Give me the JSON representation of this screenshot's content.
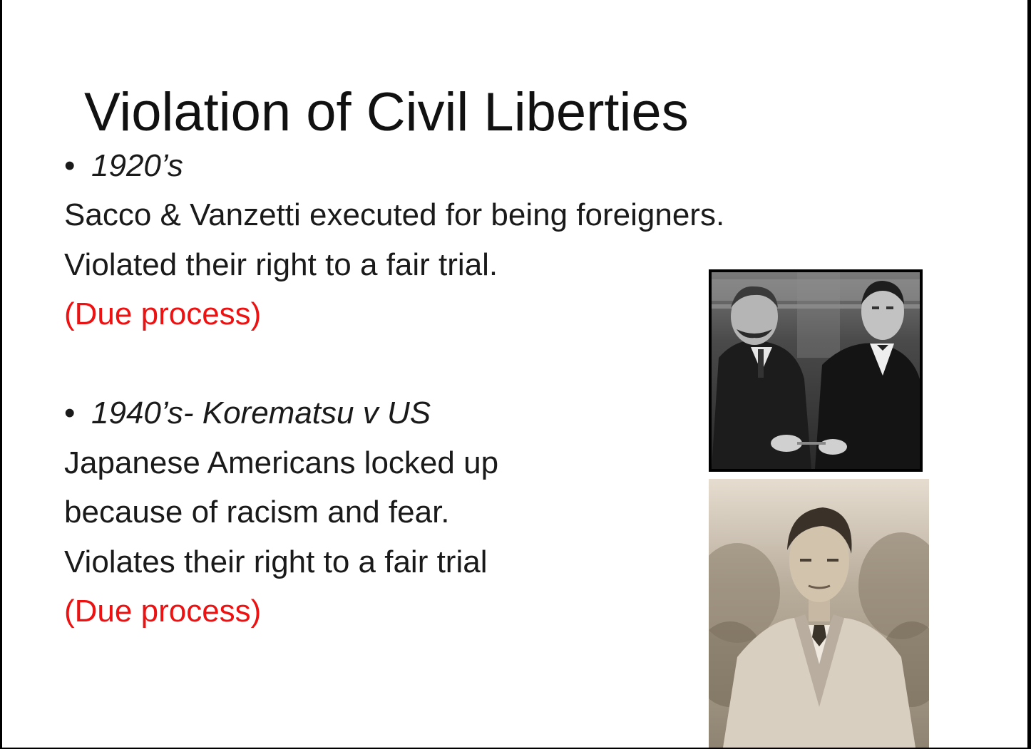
{
  "slide": {
    "title": "Violation of Civil Liberties",
    "section1": {
      "bullet": "•",
      "heading": "1920’s",
      "line1": "Sacco & Vanzetti executed for being foreigners.",
      "line2": "Violated their right to a fair trial.",
      "line3": "(Due process)"
    },
    "section2": {
      "bullet": "•",
      "heading": "1940’s- Korematsu v US",
      "line1": "Japanese Americans locked up",
      "line2": "because of racism and fear.",
      "line3": "Violates their right to a fair trial",
      "line4": "(Due process)"
    }
  },
  "colors": {
    "background": "#ffffff",
    "text": "#1a1a1a",
    "accent_red": "#ee1111"
  }
}
